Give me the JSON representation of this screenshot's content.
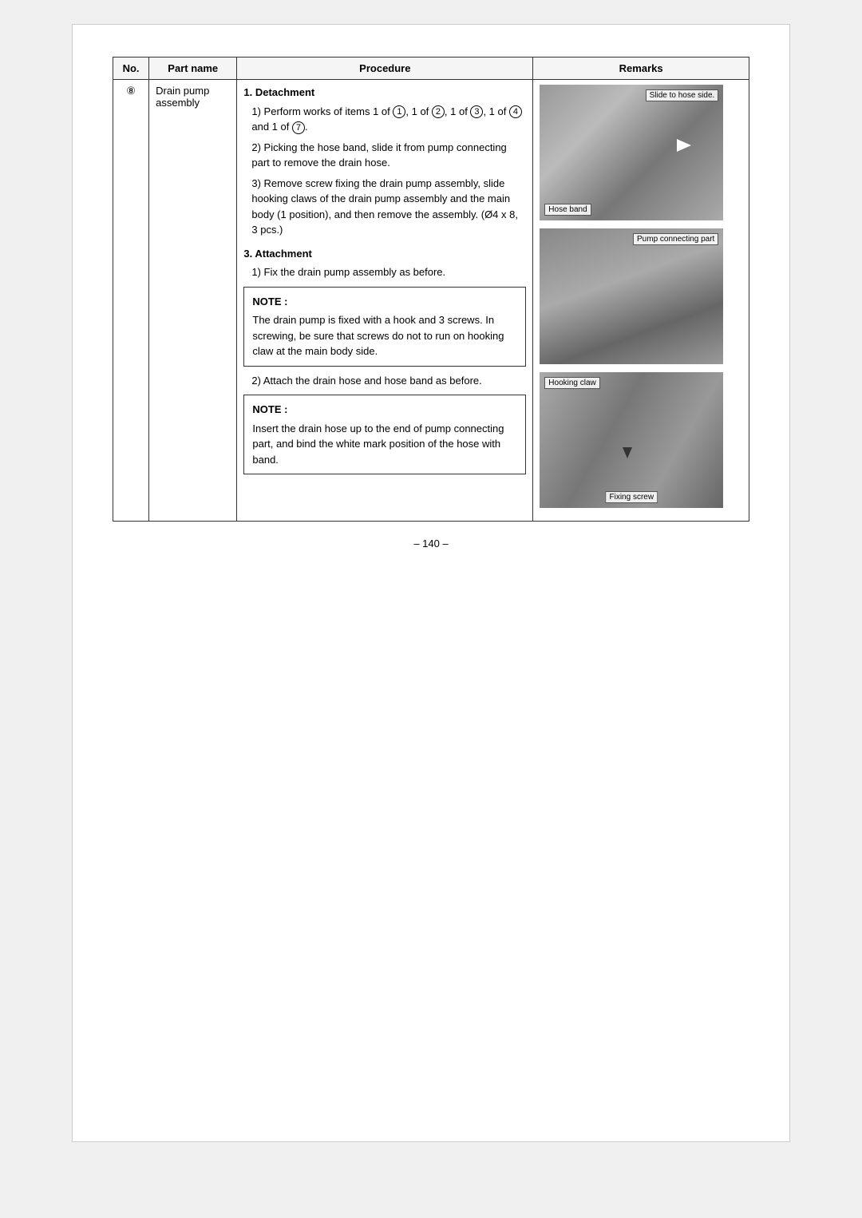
{
  "page": {
    "page_number": "– 140 –"
  },
  "table": {
    "headers": {
      "no": "No.",
      "part_name": "Part name",
      "procedure": "Procedure",
      "remarks": "Remarks"
    },
    "row": {
      "no": "⑧",
      "part_name": "Drain pump assembly",
      "detachment_title": "1.  Detachment",
      "step1": "1) Perform works of items 1 of ①, 1 of ②, 1 of ③, 1 of ④ and 1 of ⑦.",
      "step2": "2) Picking the hose band, slide it from pump connecting part to remove the drain hose.",
      "step3": "3) Remove screw fixing the drain pump assembly, slide hooking claws of the drain pump assembly and the main body (1 position), and then remove the assembly. (Ø4 x 8, 3 pcs.)",
      "attachment_title": "3.  Attachment",
      "att_step1": "1) Fix the drain pump assembly as before.",
      "note1_title": "NOTE :",
      "note1_body": "The drain pump is fixed with a hook and 3 screws. In screwing, be sure that screws do not to run on hooking claw at the main body side.",
      "att_step2": "2)  Attach the drain hose and hose band as before.",
      "note2_title": "NOTE :",
      "note2_body": "Insert the drain hose up to the end of pump connecting part, and bind the white mark position of the hose with band.",
      "img1_label_top": "Slide to hose side.",
      "img1_label_bottom": "Hose band",
      "img2_label_top": "Pump connecting part",
      "img3_label_top": "Hooking claw",
      "img3_label_bottom": "Fixing screw"
    }
  }
}
